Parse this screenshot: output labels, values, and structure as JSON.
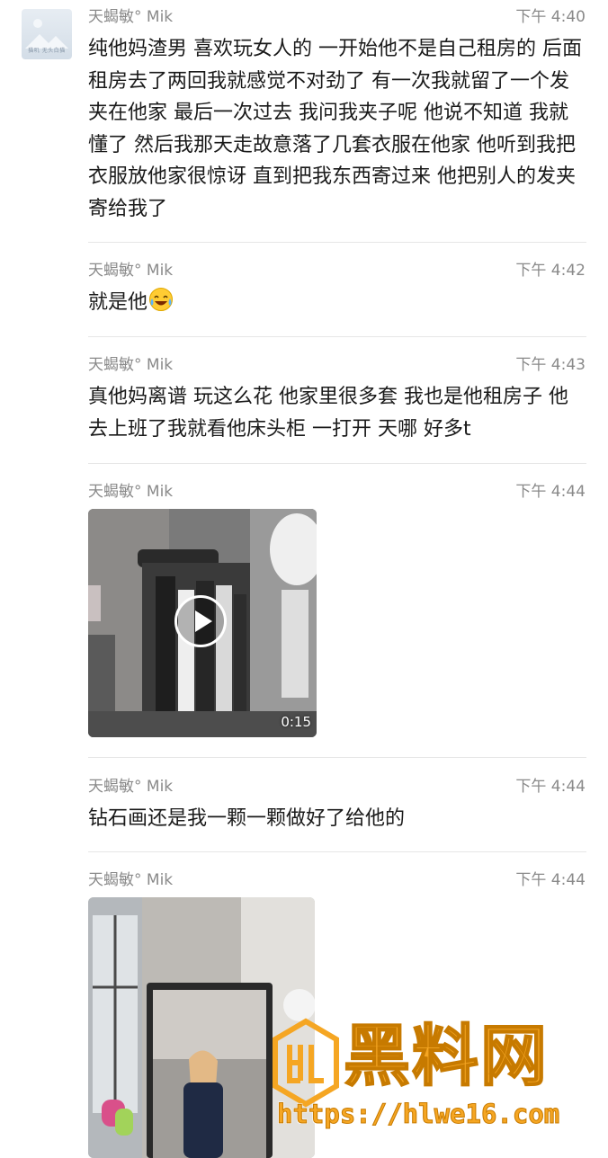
{
  "avatar": {
    "caption": "猫叽 无头白猫"
  },
  "messages": [
    {
      "sender": "天蝎敏° Mik",
      "time": "下午 4:40",
      "text": "纯他妈渣男 喜欢玩女人的  一开始他不是自己租房的 后面租房去了两回我就感觉不对劲了 有一次我就留了一个发夹在他家 最后一次过去 我问我夹子呢 他说不知道 我就懂了  然后我那天走故意落了几套衣服在他家  他听到我把衣服放他家很惊讶  直到把我东西寄过来 他把别人的发夹寄给我了"
    },
    {
      "sender": "天蝎敏° Mik",
      "time": "下午 4:42",
      "text": "就是他",
      "emoji": "laughing-crying-emoji"
    },
    {
      "sender": "天蝎敏° Mik",
      "time": "下午 4:43",
      "text": "真他妈离谱 玩这么花  他家里很多套 我也是他租房子 他去上班了我就看他床头柜 一打开 天哪 好多t"
    },
    {
      "sender": "天蝎敏° Mik",
      "time": "下午 4:44",
      "video": {
        "duration": "0:15"
      }
    },
    {
      "sender": "天蝎敏° Mik",
      "time": "下午 4:44",
      "text": "钻石画还是我一颗一颗做好了给他的"
    },
    {
      "sender": "天蝎敏° Mik",
      "time": "下午 4:44",
      "image": "photo"
    }
  ],
  "watermark": {
    "brand": "黑料网",
    "url": "https://hlwe16.com",
    "color": "#f5a623"
  }
}
